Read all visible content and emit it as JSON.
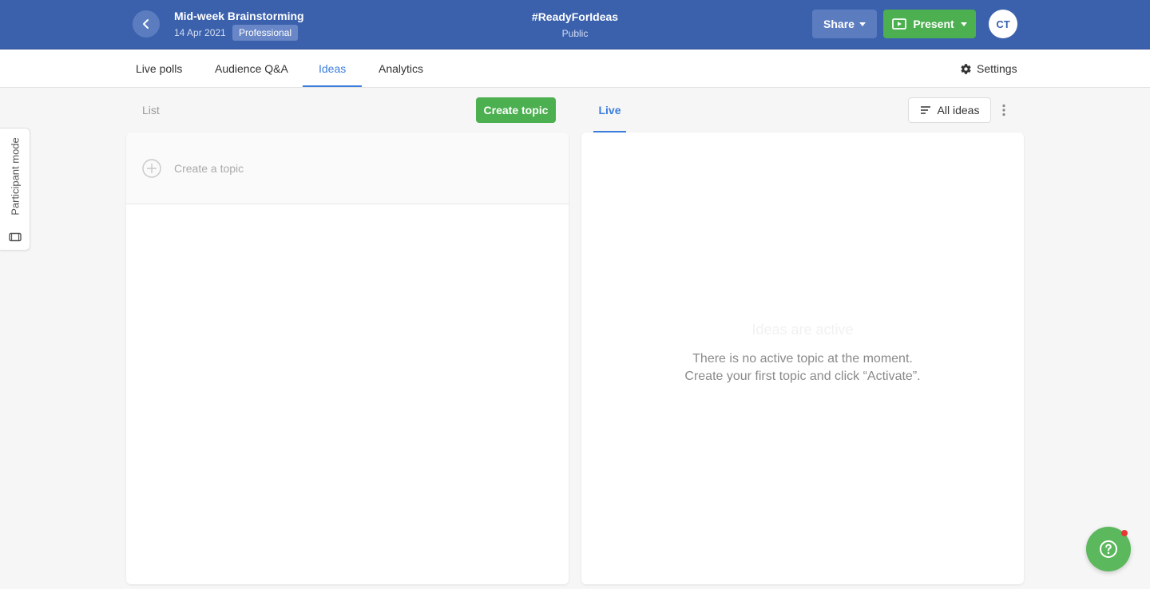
{
  "header": {
    "event_title": "Mid-week Brainstorming",
    "event_date": "14 Apr 2021",
    "plan_badge": "Professional",
    "event_code": "#ReadyForIdeas",
    "event_visibility": "Public",
    "share_label": "Share",
    "present_label": "Present",
    "avatar_initials": "CT"
  },
  "nav": {
    "tabs": [
      {
        "label": "Live polls"
      },
      {
        "label": "Audience Q&A"
      },
      {
        "label": "Ideas"
      },
      {
        "label": "Analytics"
      }
    ],
    "active_tab": "Ideas",
    "settings_label": "Settings"
  },
  "side": {
    "participant_mode_label": "Participant mode"
  },
  "list": {
    "header_label": "List",
    "create_button_label": "Create topic",
    "create_row_placeholder": "Create a topic"
  },
  "live": {
    "tab_label": "Live",
    "filter_label": "All ideas",
    "empty_title": "Ideas are active",
    "empty_line_1": "There is no active topic at the moment.",
    "empty_line_2": "Create your first topic and click “Activate”."
  },
  "colors": {
    "header_blue": "#3b61ad",
    "accent_blue": "#3b7ddd",
    "green": "#4caf50",
    "notification_red": "#e53935"
  },
  "icons": {
    "back": "chevron-left-icon",
    "share": "caret-down-icon",
    "present": "present-screen-icon",
    "settings": "gear-icon",
    "participant": "device-icon",
    "create": "plus-circle-icon",
    "filter": "sort-lines-icon",
    "more": "more-vertical-icon",
    "help": "question-circle-icon"
  }
}
